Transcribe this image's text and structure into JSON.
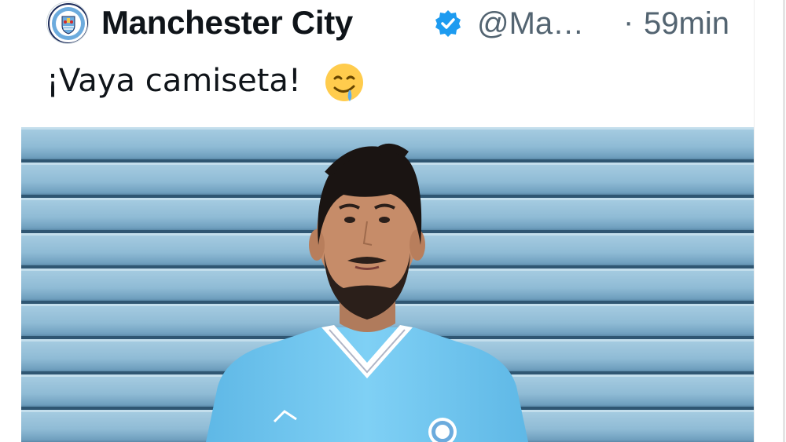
{
  "tweet": {
    "author": {
      "display_name": "Manchester City",
      "handle": "@Ma…",
      "verified": true,
      "avatar_icon": "man-city-crest-icon",
      "verified_icon": "verified-badge-icon"
    },
    "separator": "·",
    "timestamp": "59min",
    "text": "¡Vaya camiseta!",
    "emoji_icon": "drooling-face-emoji-icon",
    "media": {
      "description": "",
      "icon": "photo-media"
    }
  },
  "colors": {
    "text_primary": "#0f1419",
    "text_secondary": "#536471",
    "verified_blue": "#1d9bf0",
    "kit_sky_blue": "#6cc4ef",
    "background": "#ffffff"
  }
}
